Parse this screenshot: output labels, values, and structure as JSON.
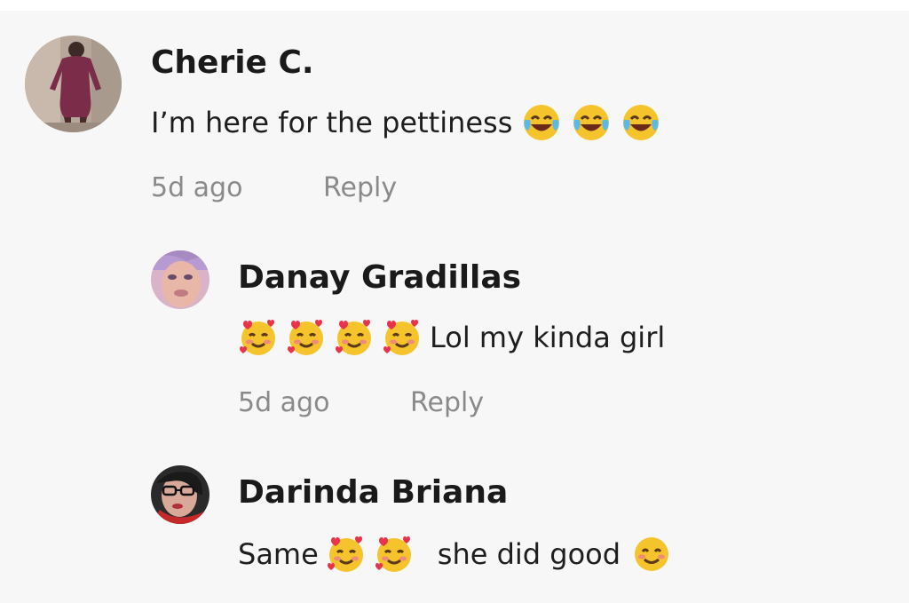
{
  "comments": [
    {
      "username": "Cherie C.",
      "text_main": "I’m here for the pettiness",
      "emojis": [
        "face-with-tears-of-joy-icon",
        "face-with-tears-of-joy-icon",
        "face-with-tears-of-joy-icon"
      ],
      "timestamp": "5d ago",
      "reply_label": "Reply"
    },
    {
      "username": "Danay Gradillas",
      "emojis": [
        "smiling-face-with-hearts-icon",
        "smiling-face-with-hearts-icon",
        "smiling-face-with-hearts-icon",
        "smiling-face-with-hearts-icon"
      ],
      "text_main": "Lol my kinda girl",
      "timestamp": "5d ago",
      "reply_label": "Reply"
    },
    {
      "username": "Darinda Briana",
      "text_start": "Same",
      "emojis_mid": [
        "smiling-face-with-hearts-icon",
        "smiling-face-with-hearts-icon"
      ],
      "text_end": "she did good",
      "emoji_end": "smiling-face-with-smiling-eyes-icon"
    }
  ],
  "colors": {
    "background": "#f7f7f7",
    "username": "#1a1a1a",
    "body_text": "#1e1e1e",
    "meta_text": "#8a8a8a"
  }
}
